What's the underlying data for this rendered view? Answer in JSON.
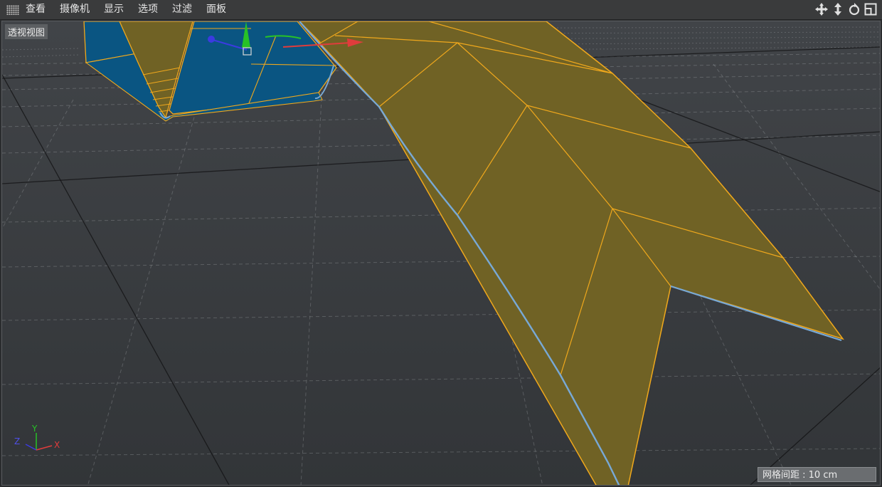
{
  "menu": {
    "items": [
      {
        "label": "查看"
      },
      {
        "label": "摄像机"
      },
      {
        "label": "显示"
      },
      {
        "label": "选项"
      },
      {
        "label": "过滤"
      },
      {
        "label": "面板"
      }
    ]
  },
  "nav_icons": [
    "move-view-icon",
    "dolly-view-icon",
    "rotate-view-icon",
    "maximize-view-icon"
  ],
  "viewport": {
    "label": "透视视图",
    "grid_spacing": "网格间距 : 10 cm",
    "axes": {
      "y": "Y",
      "z": "Z",
      "x": "X"
    }
  },
  "colors": {
    "background": "#3a3d40",
    "selected_face": "#706225",
    "edge": "#f0a81c",
    "unselected_face": "#0a5582",
    "axis_x": "#e03c3c",
    "axis_y": "#27c227",
    "axis_z": "#3b3be0"
  }
}
